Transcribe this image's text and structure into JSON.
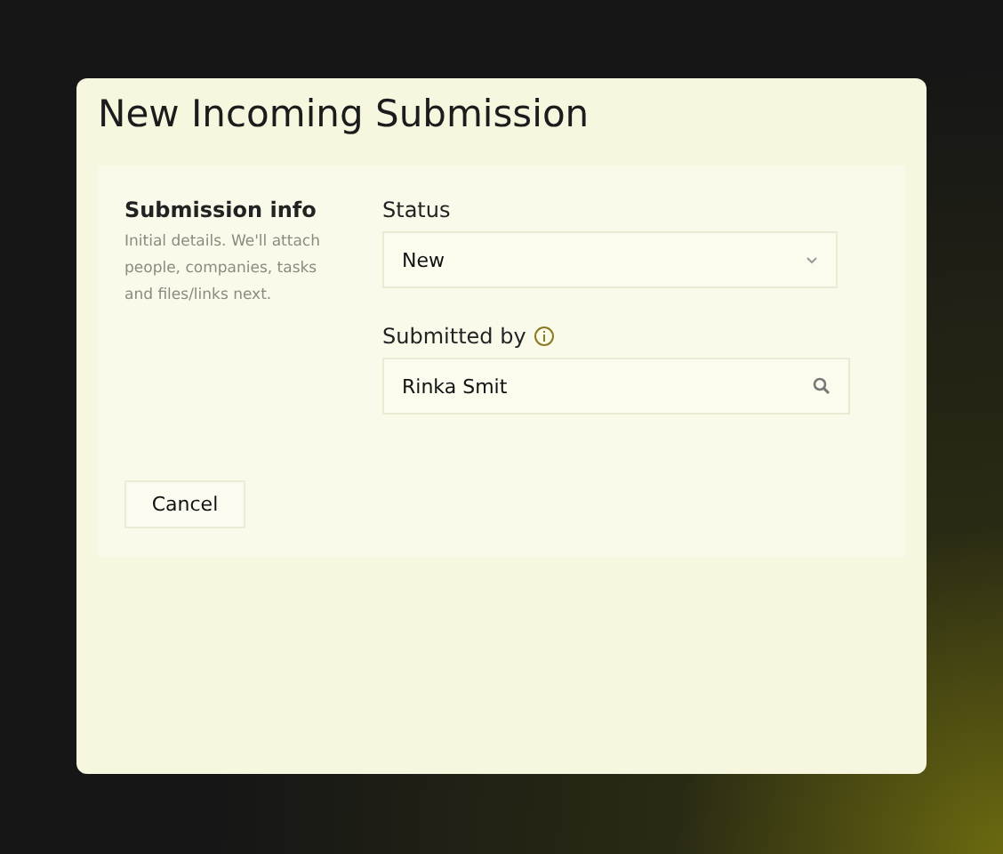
{
  "dialog": {
    "title": "New Incoming Submission"
  },
  "section": {
    "title": "Submission info",
    "description": "Initial details. We'll attach people, companies, tasks and files/links next."
  },
  "status": {
    "label": "Status",
    "value": "New"
  },
  "submitted_by": {
    "label": "Submitted by",
    "value": "Rinka Smit"
  },
  "buttons": [
    {
      "label": "Cancel"
    }
  ]
}
